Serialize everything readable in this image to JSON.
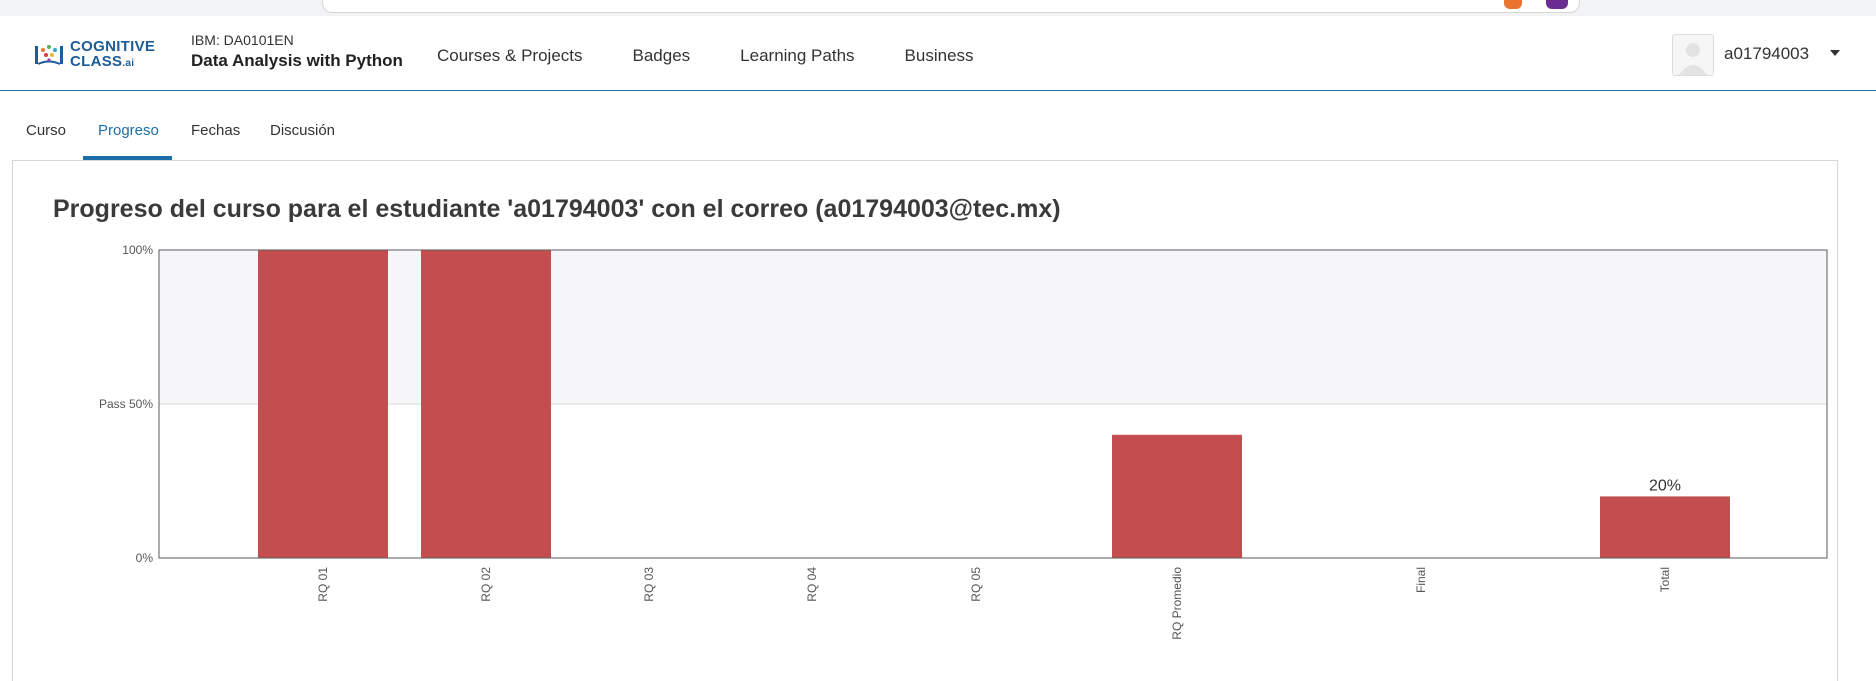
{
  "header": {
    "logo": {
      "line1": "COGNITIVE",
      "line2": "CLASS",
      "suffix": ".ai"
    },
    "course_id": "IBM: DA0101EN",
    "course_name": "Data Analysis with Python",
    "nav": [
      {
        "label": "Courses & Projects"
      },
      {
        "label": "Badges"
      },
      {
        "label": "Learning Paths"
      },
      {
        "label": "Business"
      }
    ],
    "user": {
      "username": "a01794003"
    }
  },
  "tabs": [
    {
      "label": "Curso",
      "active": false
    },
    {
      "label": "Progreso",
      "active": true
    },
    {
      "label": "Fechas",
      "active": false
    },
    {
      "label": "Discusión",
      "active": false
    }
  ],
  "page": {
    "title": "Progreso del curso para el estudiante 'a01794003' con el correo (a01794003@tec.mx)"
  },
  "colors": {
    "bar": "#c44d4f",
    "accent": "#1d6ea6",
    "plot_bg": "#f7f7fa"
  },
  "chart_data": {
    "type": "bar",
    "categories": [
      "RQ 01",
      "RQ 02",
      "RQ 03",
      "RQ 04",
      "RQ 05",
      "RQ Promedio",
      "Final",
      "Total"
    ],
    "values": [
      100,
      100,
      0,
      0,
      0,
      40,
      0,
      20
    ],
    "ylim": [
      0,
      100
    ],
    "yticks": [
      {
        "value": 100,
        "label": "100%"
      },
      {
        "value": 50,
        "label": "Pass 50%"
      },
      {
        "value": 0,
        "label": "0%"
      }
    ],
    "pass_line": 50,
    "data_labels": [
      {
        "category": "Total",
        "label": "20%"
      }
    ],
    "grid": false,
    "legend": "none"
  }
}
